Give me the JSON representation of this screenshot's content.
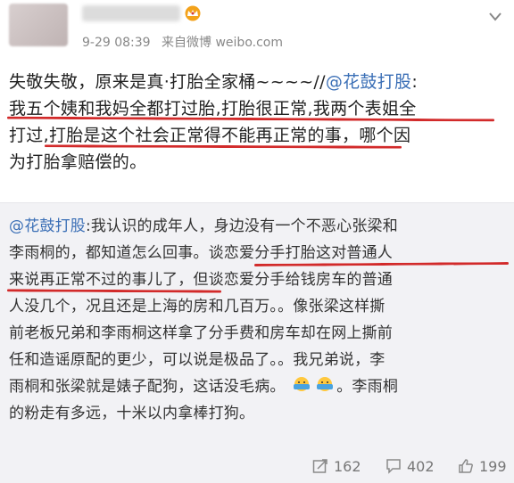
{
  "post": {
    "timestamp": "9-29 08:39",
    "source": "来自微博 weibo.com",
    "content_lines": [
      "失敬失敬，原来是真·打胎全家桶~~~~//",
      "我五个姨和我妈全都打过胎,打胎很正常,我两个表姐全",
      "打过,打胎是这个社会正常得不能再正常的事，哪个因",
      "为打胎拿赔偿的。"
    ],
    "mention": "@花鼓打股",
    "mention_suffix": ":"
  },
  "quote": {
    "mention": "@花鼓打股",
    "lines": [
      ":我认识的成年人，身边没有一个不恶心张梁和",
      "李雨桐的，都知道怎么回事。谈恋爱分手打胎这对普通人",
      "来说再正常不过的事儿了，但谈恋爱分手给钱房车的普通",
      "人没几个，况且还是上海的房和几百万。。像张梁这样撕",
      "前老板兄弟和李雨桐这样拿了分手费和房车却在网上撕前",
      "任和造谣原配的更少，可以说是极品了。。我兄弟说，李",
      "雨桐和张梁就是婊子配狗，这话没毛病。",
      "。李雨桐",
      "的粉走有多远，十米以内拿棒打狗。"
    ]
  },
  "actions": {
    "repost_count": "162",
    "comment_count": "402",
    "like_count": "199"
  },
  "colors": {
    "mention": "#3b6fb6",
    "underline": "#d22a2a",
    "quote_bg": "#f2f2f5"
  },
  "icons": [
    "vip-crown-icon",
    "chevron-down-icon",
    "repost-icon",
    "comment-icon",
    "like-icon",
    "facepalm-emoji-icon"
  ]
}
